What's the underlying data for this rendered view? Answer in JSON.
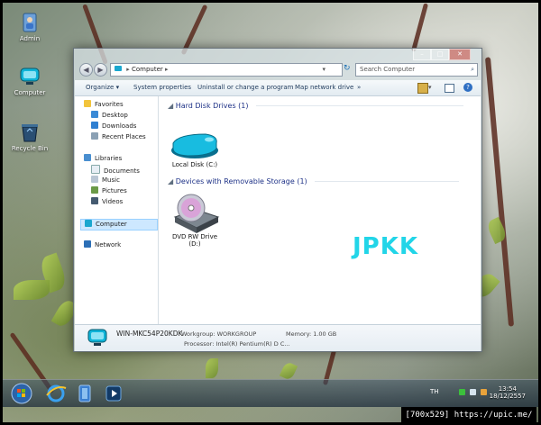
{
  "desktop": {
    "icons": [
      {
        "label": "Admin"
      },
      {
        "label": "Computer"
      },
      {
        "label": "Recycle Bin"
      }
    ]
  },
  "window": {
    "address": {
      "segments": [
        "Computer"
      ]
    },
    "search_placeholder": "Search Computer",
    "toolbar": {
      "organize": "Organize",
      "system_properties": "System properties",
      "uninstall": "Uninstall or change a program",
      "map_network": "Map network drive",
      "more": "»"
    },
    "nav": {
      "favorites": "Favorites",
      "desktop": "Desktop",
      "downloads": "Downloads",
      "recent": "Recent Places",
      "libraries": "Libraries",
      "documents": "Documents",
      "music": "Music",
      "pictures": "Pictures",
      "videos": "Videos",
      "computer": "Computer",
      "network": "Network"
    },
    "groups": {
      "hdd": {
        "title": "Hard Disk Drives (1)",
        "items": [
          {
            "label": "Local Disk (C:)"
          }
        ]
      },
      "removable": {
        "title": "Devices with Removable Storage (1)",
        "items": [
          {
            "label_line1": "DVD RW Drive",
            "label_line2": "(D:)"
          }
        ]
      }
    },
    "details": {
      "computer_name": "WIN-MKC54P20KDK",
      "workgroup": "Workgroup: WORKGROUP",
      "memory": "Memory: 1.00 GB",
      "processor": "Processor: Intel(R) Pentium(R) D C..."
    }
  },
  "overlay_text": "JPKK",
  "taskbar": {
    "language": "TH",
    "time": "13:54",
    "date": "18/12/2557"
  },
  "watermark": "[700x529] https://upic.me/"
}
